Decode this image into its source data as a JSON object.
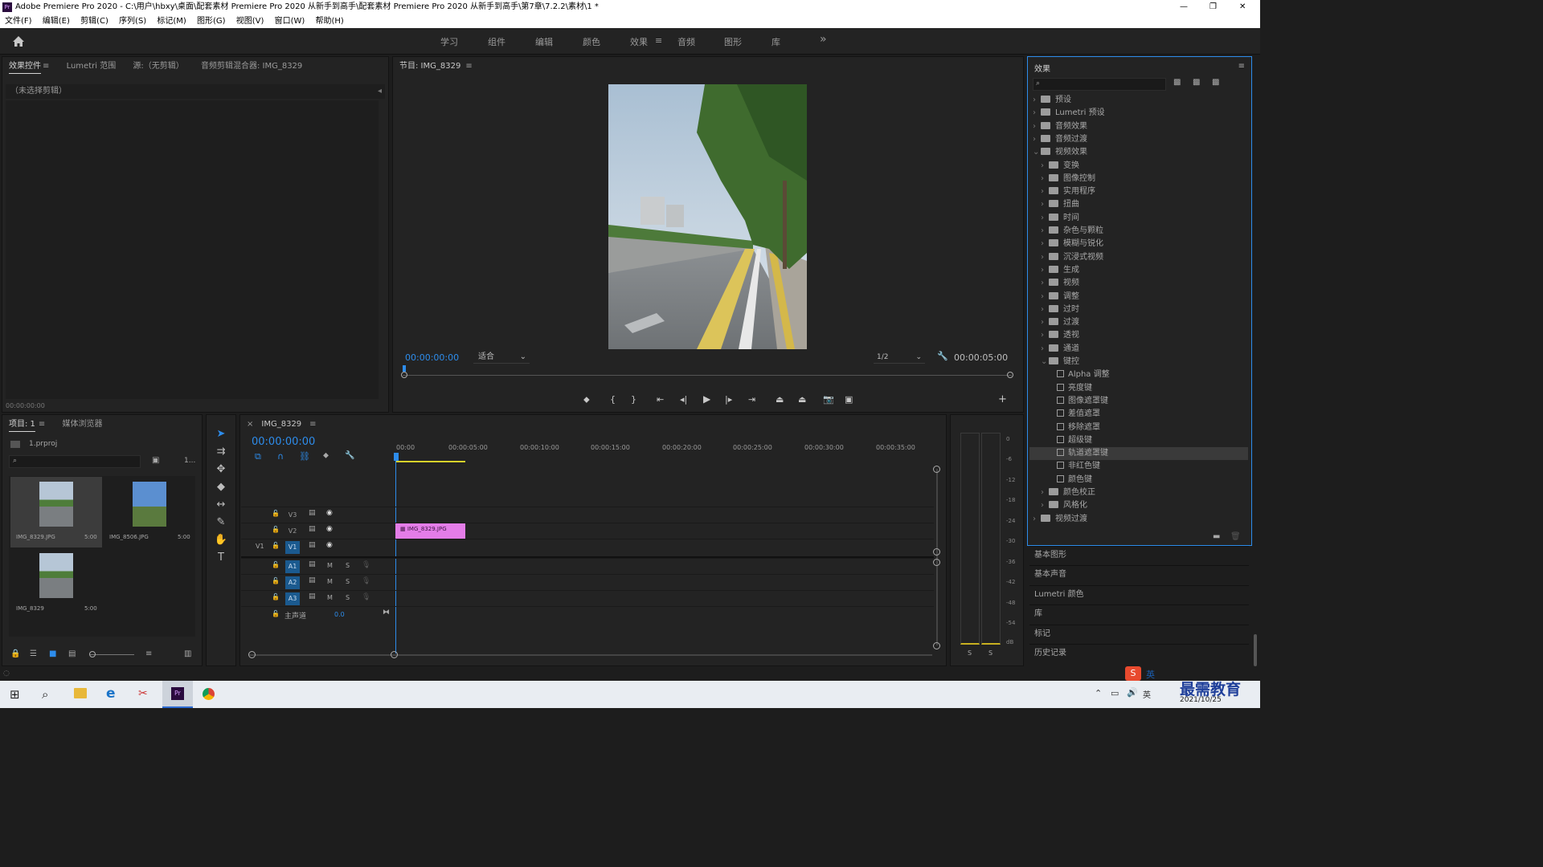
{
  "window": {
    "title": "Adobe Premiere Pro 2020 - C:\\用户\\hbxy\\桌面\\配套素材 Premiere Pro 2020 从新手到高手\\配套素材 Premiere Pro 2020 从新手到高手\\第7章\\7.2.2\\素材\\1 *",
    "app_icon": "Pr",
    "controls": [
      "—",
      "❐",
      "✕"
    ]
  },
  "menu": [
    "文件(F)",
    "编辑(E)",
    "剪辑(C)",
    "序列(S)",
    "标记(M)",
    "图形(G)",
    "视图(V)",
    "窗口(W)",
    "帮助(H)"
  ],
  "workspaces": {
    "tabs": [
      "学习",
      "组件",
      "编辑",
      "颜色",
      "效果",
      "音频",
      "图形",
      "库"
    ],
    "active": "效果",
    "more": "»",
    "menu_icon": "≡"
  },
  "effect_controls": {
    "tabs": [
      "效果控件",
      "Lumetri 范围",
      "源:（无剪辑）",
      "音频剪辑混合器: IMG_8329"
    ],
    "menu_icon": "≡",
    "no_clip": "（未选择剪辑）",
    "timecode": "00:00:00:00"
  },
  "program": {
    "title": "节目: IMG_8329",
    "menu_icon": "≡",
    "timecode": "00:00:00:00",
    "fit": "适合",
    "resolution": "1/2",
    "duration": "00:00:05:00"
  },
  "project": {
    "tabs": [
      "项目: 1",
      "媒体浏览器"
    ],
    "menu_icon": "≡",
    "file": "1.prproj",
    "count": "1...",
    "items": [
      {
        "name": "IMG_8329.JPG",
        "dur": "5:00"
      },
      {
        "name": "IMG_8506.JPG",
        "dur": "5:00"
      },
      {
        "name": "IMG_8329",
        "dur": "5:00"
      }
    ]
  },
  "timeline": {
    "tab": "IMG_8329",
    "close": "×",
    "menu_icon": "≡",
    "timecode": "00:00:00:00",
    "ruler": [
      "00:00",
      "00:00:05:00",
      "00:00:10:00",
      "00:00:15:00",
      "00:00:20:00",
      "00:00:25:00",
      "00:00:30:00",
      "00:00:35:00"
    ],
    "tracks": [
      {
        "id": "V3"
      },
      {
        "id": "V2"
      },
      {
        "id": "V1",
        "src": "V1"
      },
      {
        "id": "A1"
      },
      {
        "id": "A2"
      },
      {
        "id": "A3"
      }
    ],
    "ms": [
      "M",
      "S"
    ],
    "master": "主声道",
    "master_val": "0.0",
    "clip": "IMG_8329.JPG"
  },
  "meter": {
    "ticks": [
      "0",
      "-6",
      "-12",
      "-18",
      "-24",
      "-30",
      "-36",
      "-42",
      "-48",
      "-54",
      "dB"
    ],
    "solo": [
      "S",
      "S"
    ]
  },
  "effects_panel": {
    "title": "效果",
    "menu_icon": "≡",
    "tree": [
      {
        "label": "预设",
        "lvl": 0,
        "type": "star"
      },
      {
        "label": "Lumetri 预设",
        "lvl": 0,
        "type": "star"
      },
      {
        "label": "音频效果",
        "lvl": 0,
        "type": "folder"
      },
      {
        "label": "音频过渡",
        "lvl": 0,
        "type": "folder"
      },
      {
        "label": "视频效果",
        "lvl": 0,
        "type": "folder",
        "open": true
      },
      {
        "label": "变换",
        "lvl": 1,
        "type": "folder"
      },
      {
        "label": "图像控制",
        "lvl": 1,
        "type": "folder"
      },
      {
        "label": "实用程序",
        "lvl": 1,
        "type": "folder"
      },
      {
        "label": "扭曲",
        "lvl": 1,
        "type": "folder"
      },
      {
        "label": "时间",
        "lvl": 1,
        "type": "folder"
      },
      {
        "label": "杂色与颗粒",
        "lvl": 1,
        "type": "folder"
      },
      {
        "label": "模糊与锐化",
        "lvl": 1,
        "type": "folder"
      },
      {
        "label": "沉浸式视频",
        "lvl": 1,
        "type": "folder"
      },
      {
        "label": "生成",
        "lvl": 1,
        "type": "folder"
      },
      {
        "label": "视频",
        "lvl": 1,
        "type": "folder"
      },
      {
        "label": "调整",
        "lvl": 1,
        "type": "folder"
      },
      {
        "label": "过时",
        "lvl": 1,
        "type": "folder"
      },
      {
        "label": "过渡",
        "lvl": 1,
        "type": "folder"
      },
      {
        "label": "透视",
        "lvl": 1,
        "type": "folder"
      },
      {
        "label": "通道",
        "lvl": 1,
        "type": "folder"
      },
      {
        "label": "键控",
        "lvl": 1,
        "type": "folder",
        "open": true
      },
      {
        "label": "Alpha 调整",
        "lvl": 2,
        "type": "fx"
      },
      {
        "label": "亮度键",
        "lvl": 2,
        "type": "fx"
      },
      {
        "label": "图像遮罩键",
        "lvl": 2,
        "type": "fx"
      },
      {
        "label": "差值遮罩",
        "lvl": 2,
        "type": "fx"
      },
      {
        "label": "移除遮罩",
        "lvl": 2,
        "type": "fx"
      },
      {
        "label": "超级键",
        "lvl": 2,
        "type": "fx"
      },
      {
        "label": "轨道遮罩键",
        "lvl": 2,
        "type": "fx",
        "selected": true
      },
      {
        "label": "非红色键",
        "lvl": 2,
        "type": "fx"
      },
      {
        "label": "颜色键",
        "lvl": 2,
        "type": "fx"
      },
      {
        "label": "颜色校正",
        "lvl": 1,
        "type": "folder"
      },
      {
        "label": "风格化",
        "lvl": 1,
        "type": "folder"
      },
      {
        "label": "视频过渡",
        "lvl": 0,
        "type": "folder"
      }
    ],
    "side": [
      "基本图形",
      "基本声音",
      "Lumetri 颜色",
      "库",
      "标记",
      "历史记录"
    ]
  },
  "taskbar": {
    "date": "2021/10/25",
    "ime": "英",
    "watermark": "最需教育"
  },
  "colors": {
    "accent": "#2d8ceb",
    "clip": "#e47de8",
    "playhead": "#2d8ceb"
  }
}
